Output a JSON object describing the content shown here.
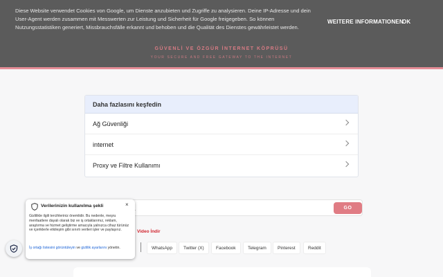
{
  "cookie_banner": {
    "text": "Diese Website verwendet Cookies von Google, um Dienste anzubieten und Zugriffe zu analysieren. Deine IP-Adresse und dein User-Agent werden zusammen mit Messwerten zur Leistung und Sicherheit für Google freigegeben. So können Nutzungsstatistiken generiert, Missbrauchsfälle erkannt und behoben und die Qualität des Dienstes gewährleistet werden.",
    "more_label": "WEITERE INFORMATIONEN",
    "ok_label": "OK"
  },
  "header": {
    "subtitle": "GÜVENLİ VE ÖZGÜR İNTERNET KÖPRÜSÜ",
    "tagline": "YOUR SECURE AND FREE GATEWAY TO THE INTERNET"
  },
  "explore": {
    "heading": "Daha fazlasını keşfedin",
    "items": [
      {
        "label": "Ağ Güvenliği"
      },
      {
        "label": "internet"
      },
      {
        "label": "Proxy ve Filtre Kullanımı"
      }
    ]
  },
  "url_form": {
    "placeholder": "ebsite Address...",
    "go_label": "GO"
  },
  "video_link": "Video İndir",
  "share": {
    "buttons": [
      "WhatsApp",
      "Twitter (X)",
      "Facebook",
      "Telegram",
      "Pinterest",
      "Reddit"
    ]
  },
  "privacy_popup": {
    "title": "Verilerinizin kullanılma şekli",
    "close": "×",
    "body": "Gizlilikle ilgili tercihleriniz önemlidir. Bu nedenle, meşru menfaatlere dayalı olarak biz ve iş ortaklarımız, reklam, araştırma ve hizmet geliştirme amacıyla yalnızca cihaz türünüz ve içeriklerle etkileşim gibi sınırlı verileri işler ve paylaşırız.",
    "link1": "İş ortağı listesini görüntüleyin",
    "connector": " ve ",
    "link2": "gizlilik ayarlarını",
    "suffix": " yönetin."
  },
  "colors": {
    "accent": "#e07c84",
    "header_bg": "#5b5b5b",
    "link": "#1a62d6",
    "video_red": "#d1252f"
  }
}
